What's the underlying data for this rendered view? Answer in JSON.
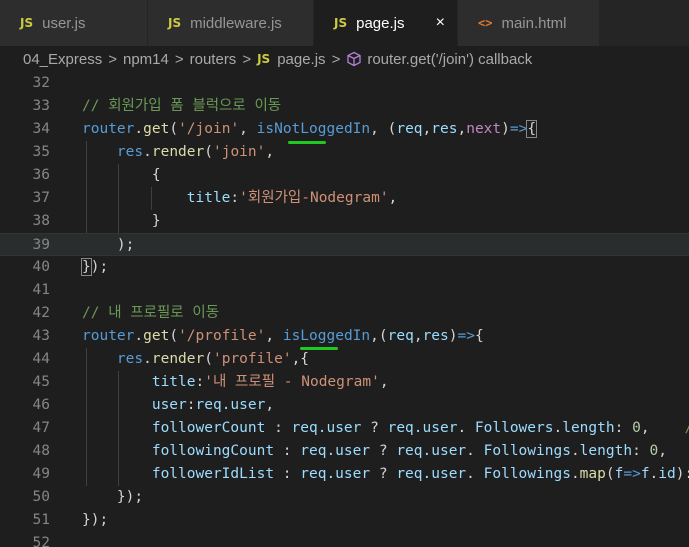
{
  "tabs": [
    {
      "label": "user.js",
      "type": "js"
    },
    {
      "label": "middleware.js",
      "type": "js"
    },
    {
      "label": "page.js",
      "type": "js",
      "active": true
    },
    {
      "label": "main.html",
      "type": "html"
    }
  ],
  "tab_close_glyph": "×",
  "js_badge": "JS",
  "html_badge": "<>",
  "breadcrumb": {
    "items": [
      "04_Express",
      "npm14",
      "routers",
      "page.js",
      "router.get('/join') callback"
    ],
    "separator": ">"
  },
  "colors": {
    "background": "#1e1e1e",
    "comment": "#6a9955",
    "keyword": "#569cd6",
    "function": "#dcdcaa",
    "string": "#ce9178",
    "variable": "#9cdcfe",
    "underline": "#22c822"
  },
  "code": {
    "line_numbers": [
      "32",
      "33",
      "34",
      "35",
      "36",
      "37",
      "38",
      "39",
      "40",
      "41",
      "42",
      "43",
      "44",
      "45",
      "46",
      "47",
      "48",
      "49",
      "50",
      "51",
      "52"
    ],
    "l33": "// 회원가입 폼 블럭으로 이동",
    "router": "router",
    "get": "get",
    "join_path": "'/join'",
    "isNotLoggedIn": "isNotLoggedIn",
    "req": "req",
    "res": "res",
    "next": "next",
    "render": "render",
    "join_view": "'join'",
    "title_key": "title",
    "join_title": "'회원가입-Nodegram'",
    "l42": "// 내 프로필로 이동",
    "profile_path": "'/profile'",
    "isLoggedIn": "isLoggedIn",
    "profile_view": "'profile'",
    "profile_title": "'내 프로필 - Nodegram'",
    "user_key": "user",
    "user_val": "req.user",
    "followerCount": "followerCount",
    "followingCount": "followingCount",
    "followerIdList": "followerIdList",
    "Followers": "Followers",
    "Followings": "Followings",
    "length": "length",
    "map": "map",
    "zero": "0",
    "f": "f",
    "id": "id",
    "l47_tail": "//",
    "l48_tail": "/",
    "l49_tail": "[]"
  }
}
